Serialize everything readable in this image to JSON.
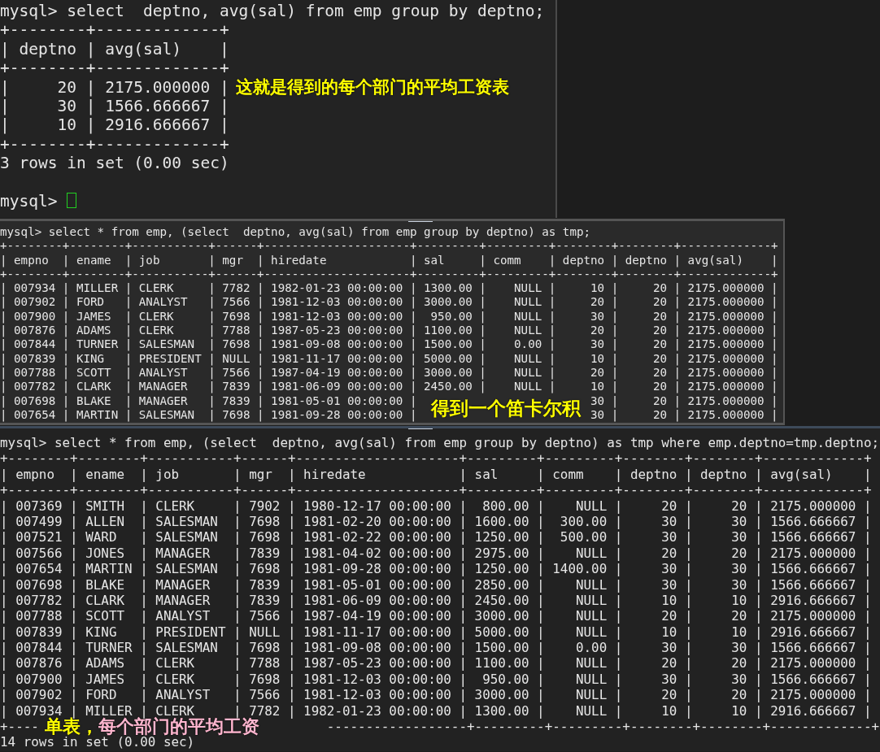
{
  "panels": [
    {
      "cursor": true,
      "lines": [
        "mysql> select  deptno, avg(sal) from emp group by deptno;",
        "+--------+-------------+",
        "| deptno | avg(sal)    |",
        "+--------+-------------+",
        "|     20 | 2175.000000 |",
        "|     30 | 1566.666667 |",
        "|     10 | 2916.666667 |",
        "+--------+-------------+",
        "3 rows in set (0.00 sec)",
        "mysql> "
      ],
      "notes": [
        {
          "parts": [
            {
              "text": "这就是得到的每个部门的平均工资表",
              "color": "#ffff00"
            }
          ]
        }
      ]
    },
    {
      "lines": [
        "mysql> select * from emp, (select  deptno, avg(sal) from emp group by deptno) as tmp;",
        "+--------+--------+-----------+------+---------------------+---------+---------+--------+--------+-------------+",
        "| empno  | ename  | job       | mgr  | hiredate            | sal     | comm    | deptno | deptno | avg(sal)    |",
        "+--------+--------+-----------+------+---------------------+---------+---------+--------+--------+-------------+",
        "| 007934 | MILLER | CLERK     | 7782 | 1982-01-23 00:00:00 | 1300.00 |    NULL |     10 |     20 | 2175.000000 |",
        "| 007902 | FORD   | ANALYST   | 7566 | 1981-12-03 00:00:00 | 3000.00 |    NULL |     20 |     20 | 2175.000000 |",
        "| 007900 | JAMES  | CLERK     | 7698 | 1981-12-03 00:00:00 |  950.00 |    NULL |     30 |     20 | 2175.000000 |",
        "| 007876 | ADAMS  | CLERK     | 7788 | 1987-05-23 00:00:00 | 1100.00 |    NULL |     20 |     20 | 2175.000000 |",
        "| 007844 | TURNER | SALESMAN  | 7698 | 1981-09-08 00:00:00 | 1500.00 |    0.00 |     30 |     20 | 2175.000000 |",
        "| 007839 | KING   | PRESIDENT | NULL | 1981-11-17 00:00:00 | 5000.00 |    NULL |     10 |     20 | 2175.000000 |",
        "| 007788 | SCOTT  | ANALYST   | 7566 | 1987-04-19 00:00:00 | 3000.00 |    NULL |     20 |     20 | 2175.000000 |",
        "| 007782 | CLARK  | MANAGER   | 7839 | 1981-06-09 00:00:00 | 2450.00 |    NULL |     10 |     20 | 2175.000000 |",
        {
          "segments": [
            "| 007698 | BLAKE  | MANAGER   | 7839 | 1981-05-01 00:00:00 |",
            "30 |     20 | 2175.000000 |"
          ]
        },
        {
          "segments": [
            "| 007654 | MARTIN | SALESMAN  | 7698 | 1981-09-28 00:00:00 |",
            "30 |     20 | 2175.000000 |"
          ]
        }
      ],
      "notes": [
        {
          "parts": [
            {
              "text": "得到一个笛卡尔积",
              "color": "#ffff00"
            }
          ]
        }
      ]
    },
    {
      "lines": [
        "mysql> select * from emp, (select  deptno, avg(sal) from emp group by deptno) as tmp where emp.deptno=tmp.deptno;",
        "+--------+--------+-----------+------+---------------------+---------+---------+--------+--------+-------------+",
        "| empno  | ename  | job       | mgr  | hiredate            | sal     | comm    | deptno | deptno | avg(sal)    |",
        "+--------+--------+-----------+------+---------------------+---------+---------+--------+--------+-------------+",
        "| 007369 | SMITH  | CLERK     | 7902 | 1980-12-17 00:00:00 |  800.00 |    NULL |     20 |     20 | 2175.000000 |",
        "| 007499 | ALLEN  | SALESMAN  | 7698 | 1981-02-20 00:00:00 | 1600.00 |  300.00 |     30 |     30 | 1566.666667 |",
        "| 007521 | WARD   | SALESMAN  | 7698 | 1981-02-22 00:00:00 | 1250.00 |  500.00 |     30 |     30 | 1566.666667 |",
        "| 007566 | JONES  | MANAGER   | 7839 | 1981-04-02 00:00:00 | 2975.00 |    NULL |     20 |     20 | 2175.000000 |",
        "| 007654 | MARTIN | SALESMAN  | 7698 | 1981-09-28 00:00:00 | 1250.00 | 1400.00 |     30 |     30 | 1566.666667 |",
        "| 007698 | BLAKE  | MANAGER   | 7839 | 1981-05-01 00:00:00 | 2850.00 |    NULL |     30 |     30 | 1566.666667 |",
        "| 007782 | CLARK  | MANAGER   | 7839 | 1981-06-09 00:00:00 | 2450.00 |    NULL |     10 |     10 | 2916.666667 |",
        "| 007788 | SCOTT  | ANALYST   | 7566 | 1987-04-19 00:00:00 | 3000.00 |    NULL |     20 |     20 | 2175.000000 |",
        "| 007839 | KING   | PRESIDENT | NULL | 1981-11-17 00:00:00 | 5000.00 |    NULL |     10 |     10 | 2916.666667 |",
        "| 007844 | TURNER | SALESMAN  | 7698 | 1981-09-08 00:00:00 | 1500.00 |    0.00 |     30 |     30 | 1566.666667 |",
        "| 007876 | ADAMS  | CLERK     | 7788 | 1987-05-23 00:00:00 | 1100.00 |    NULL |     20 |     20 | 2175.000000 |",
        "| 007900 | JAMES  | CLERK     | 7698 | 1981-12-03 00:00:00 |  950.00 |    NULL |     30 |     30 | 1566.666667 |",
        "| 007902 | FORD   | ANALYST   | 7566 | 1981-12-03 00:00:00 | 3000.00 |    NULL |     20 |     20 | 2175.000000 |",
        "| 007934 | MILLER | CLERK     | 7782 | 1982-01-23 00:00:00 | 1300.00 |    NULL |     10 |     10 | 2916.666667 |",
        {
          "segments": [
            "+----",
            "------------------+---------+---------+--------+--------+-------------+"
          ]
        },
        "14 rows in set (0.00 sec)"
      ],
      "notes": [
        {
          "parts": [
            {
              "text": "单表，",
              "color": "#ffff00"
            },
            {
              "text": "每个部门的平均工资",
              "color": "#ffb6cf"
            }
          ]
        }
      ]
    }
  ]
}
